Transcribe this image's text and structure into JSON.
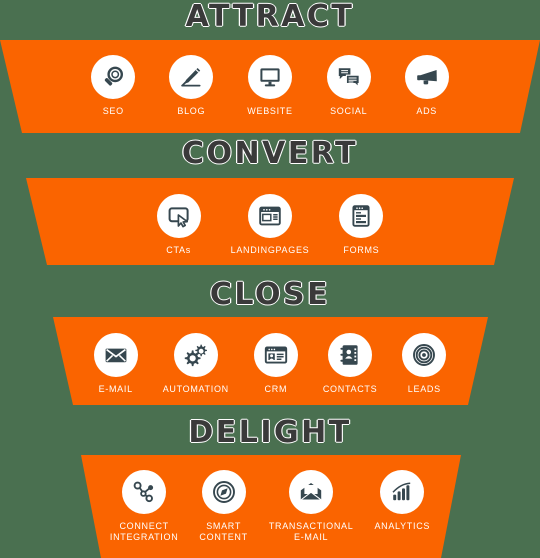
{
  "theme": {
    "background_color": "#4a7050",
    "funnel_color": "#fa6400",
    "icon_circle_color": "#ffffff",
    "icon_glyph_color": "#36474f",
    "title_color": "#3a3a3a",
    "title_outline_color": "#ffffff",
    "label_color": "#ffffff"
  },
  "diagram": {
    "type": "marketing-funnel",
    "stage_count": 4
  },
  "stages": [
    {
      "title": "ATTRACT",
      "items": [
        {
          "label": "SEO",
          "icon": "magnifying-glass-icon"
        },
        {
          "label": "BLOG",
          "icon": "pencil-icon"
        },
        {
          "label": "WEBSITE",
          "icon": "monitor-icon"
        },
        {
          "label": "SOCIAL",
          "icon": "speech-bubbles-icon"
        },
        {
          "label": "ADS",
          "icon": "megaphone-icon"
        }
      ]
    },
    {
      "title": "CONVERT",
      "items": [
        {
          "label": "CTAs",
          "icon": "cursor-screen-icon"
        },
        {
          "label": "LANDINGPAGES",
          "icon": "browser-window-icon"
        },
        {
          "label": "FORMS",
          "icon": "form-document-icon"
        }
      ]
    },
    {
      "title": "CLOSE",
      "items": [
        {
          "label": "E-MAIL",
          "icon": "envelope-icon"
        },
        {
          "label": "AUTOMATION",
          "icon": "gears-icon"
        },
        {
          "label": "CRM",
          "icon": "contact-card-icon"
        },
        {
          "label": "CONTACTS",
          "icon": "address-book-icon"
        },
        {
          "label": "LEADS",
          "icon": "target-icon"
        }
      ]
    },
    {
      "title": "DELIGHT",
      "items": [
        {
          "label": "CONNECT\nINTEGRATION",
          "icon": "network-nodes-icon"
        },
        {
          "label": "SMART\nCONTENT",
          "icon": "compass-icon"
        },
        {
          "label": "TRANSACTIONAL\nE-MAIL",
          "icon": "open-envelope-icon"
        },
        {
          "label": "ANALYTICS",
          "icon": "bar-chart-icon"
        }
      ]
    }
  ]
}
